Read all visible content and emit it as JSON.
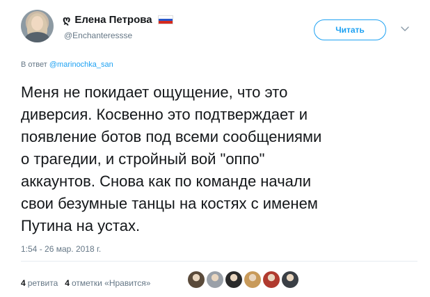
{
  "user": {
    "name_prefix": "ღ",
    "display_name": "Елена Петрова",
    "flag": "russia-flag",
    "username": "@Enchanteressse"
  },
  "follow": {
    "label": "Читать"
  },
  "reply": {
    "prefix": "В ответ",
    "handle": "@marinochka_san"
  },
  "tweet": {
    "text": "Меня не покидает ощущение, что это\nдиверсия. Косвенно это подтверждает и\nпоявление ботов под всеми сообщениями\nо трагедии, и стройный вой \"оппо\"\nаккаунтов. Снова как по команде начали\nсвои безумные танцы на костях с именем\nПутина на устах."
  },
  "timestamp": "1:54 - 26 мар. 2018 г.",
  "stats": {
    "retweets_count": "4",
    "retweets_label": "ретвита",
    "likes_count": "4",
    "likes_label": "отметки «Нравится»"
  },
  "likers": [
    {
      "icon": "liker-avatar",
      "color": "#5a4a3a"
    },
    {
      "icon": "liker-avatar",
      "color": "#9aa0a8"
    },
    {
      "icon": "liker-avatar",
      "color": "#2a2a2a"
    },
    {
      "icon": "liker-avatar",
      "color": "#c89a5a"
    },
    {
      "icon": "liker-avatar",
      "color": "#b03a2e"
    },
    {
      "icon": "liker-avatar",
      "color": "#3a3f45"
    }
  ],
  "colors": {
    "accent": "#1da1f2",
    "muted": "#657786",
    "text": "#14171a"
  }
}
